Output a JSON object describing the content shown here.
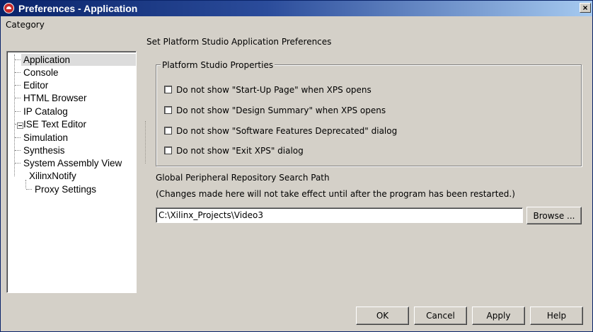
{
  "window": {
    "title": "Preferences - Application",
    "close_label": "×"
  },
  "sidebar": {
    "category_label": "Category",
    "items": [
      {
        "label": "Application",
        "selected": true
      },
      {
        "label": "Console"
      },
      {
        "label": "Editor"
      },
      {
        "label": "HTML Browser"
      },
      {
        "label": "IP Catalog"
      },
      {
        "label": "ISE Text Editor"
      },
      {
        "label": "Simulation"
      },
      {
        "label": "Synthesis"
      },
      {
        "label": "System Assembly View"
      },
      {
        "label": "XilinxNotify",
        "expanded": true,
        "children": [
          {
            "label": "Proxy Settings"
          }
        ]
      }
    ]
  },
  "main": {
    "header": "Set Platform Studio Application Preferences",
    "group_title": "Platform Studio Properties",
    "checkboxes": [
      {
        "label": "Do not show \"Start-Up Page\" when XPS opens",
        "checked": false
      },
      {
        "label": "Do not show \"Design Summary\" when XPS opens",
        "checked": false
      },
      {
        "label": "Do not show \"Software Features Deprecated\" dialog",
        "checked": false
      },
      {
        "label": "Do not show \"Exit XPS\" dialog",
        "checked": false
      }
    ],
    "repo_label": "Global Peripheral Repository Search Path",
    "repo_note": "(Changes made here will not take effect until after the program has been restarted.)",
    "repo_path": "C:\\Xilinx_Projects\\Video3",
    "browse_label": "Browse ..."
  },
  "footer": {
    "ok_label": "OK",
    "cancel_label": "Cancel",
    "apply_label": "Apply",
    "help_label": "Help"
  }
}
